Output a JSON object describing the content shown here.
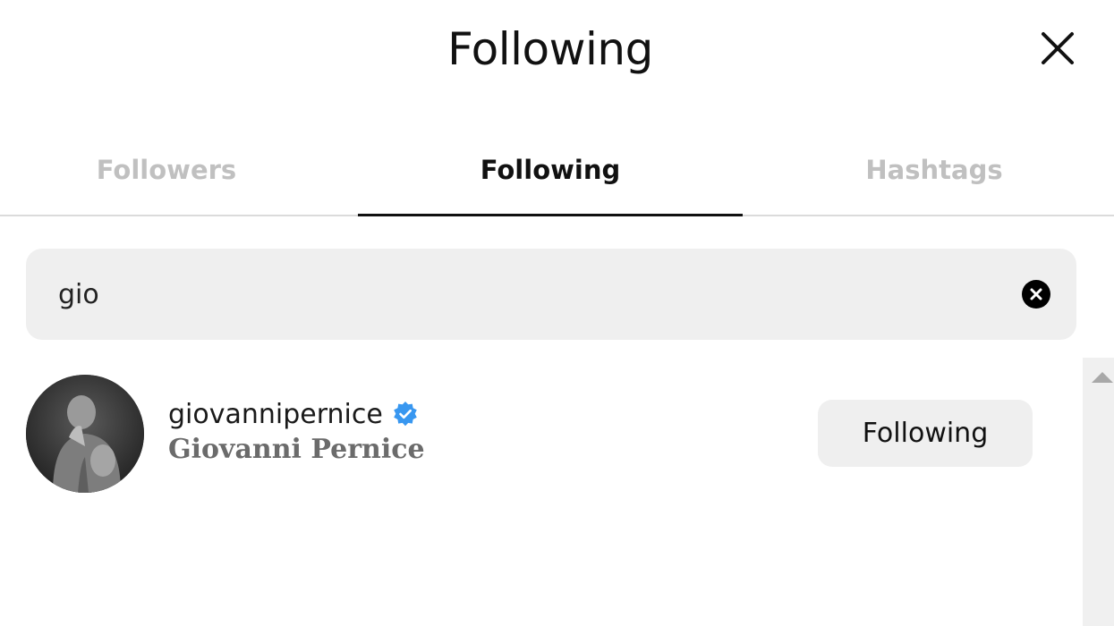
{
  "header": {
    "title": "Following"
  },
  "tabs": [
    {
      "label": "Followers",
      "active": false
    },
    {
      "label": "Following",
      "active": true
    },
    {
      "label": "Hashtags",
      "active": false
    }
  ],
  "search": {
    "value": "gio"
  },
  "results": [
    {
      "username": "giovannipernice",
      "verified": true,
      "full_name": "Giovanni Pernice",
      "button_label": "Following"
    }
  ],
  "colors": {
    "verified_badge": "#3897f0",
    "inactive_tab": "#c0c0c0",
    "button_bg": "#efefef",
    "search_bg": "#efefef"
  },
  "icons": {
    "close": "close-icon",
    "clear_search": "clear-search-icon",
    "verified": "verified-badge-icon",
    "scroll_up": "scroll-up-arrow-icon"
  }
}
